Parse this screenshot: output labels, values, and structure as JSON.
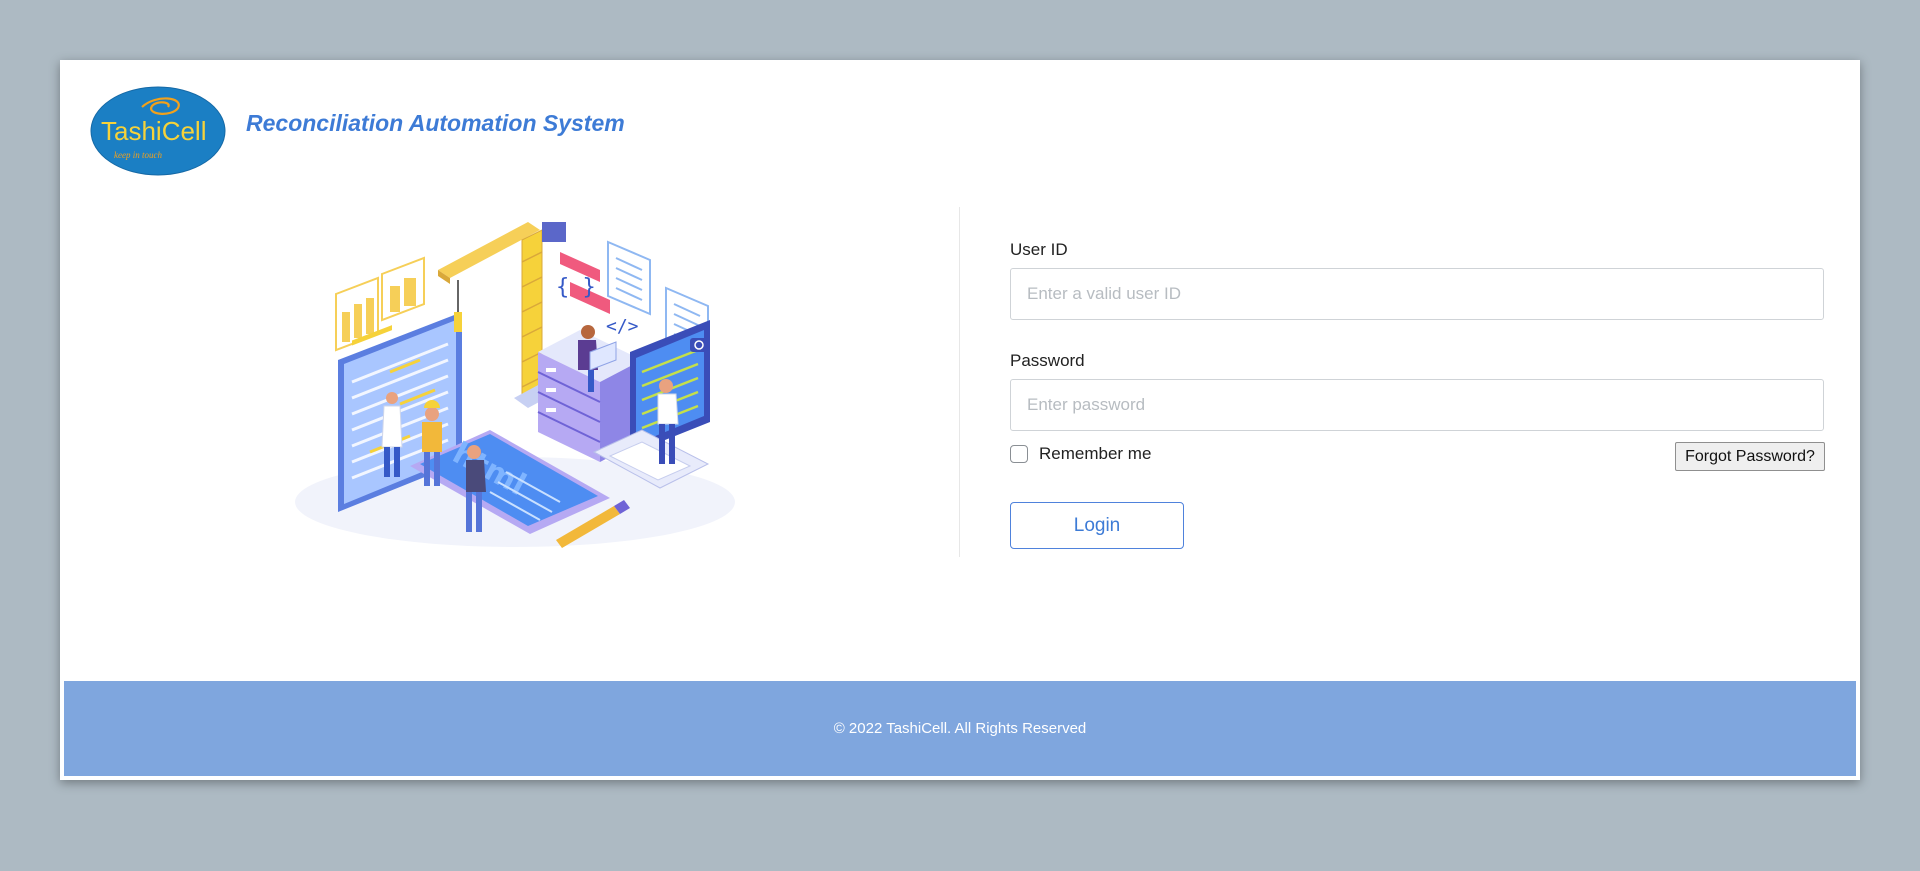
{
  "header": {
    "logo_text": "TashiCell",
    "logo_tagline": "keep in touch",
    "app_title": "Reconciliation Automation System"
  },
  "illustration": {
    "code_braces": "{ }",
    "code_tag": "</>",
    "screen_text": "html"
  },
  "login_form": {
    "user_id_label": "User ID",
    "user_id_placeholder": "Enter a valid user ID",
    "password_label": "Password",
    "password_placeholder": "Enter password",
    "remember_label": "Remember me",
    "forgot_label": "Forgot Password?",
    "login_label": "Login"
  },
  "footer": {
    "copyright": "© 2022 TashiCell. All Rights Reserved"
  },
  "colors": {
    "accent": "#3d7bd6",
    "footer_bg": "#7fa6de",
    "page_bg": "#adbac3"
  }
}
